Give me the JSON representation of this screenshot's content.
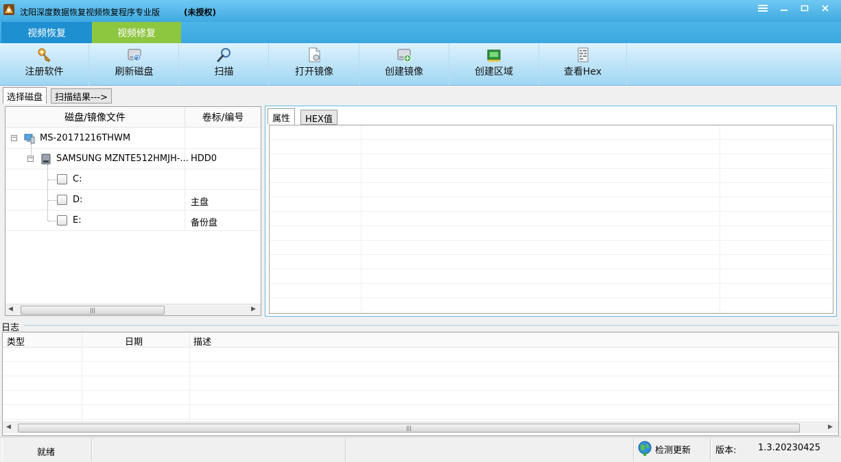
{
  "window": {
    "title": "沈阳深度数据恢复视频恢复程序专业版",
    "status": "(未授权)"
  },
  "mode_tabs": [
    {
      "label": "视频恢复"
    },
    {
      "label": "视频修复"
    }
  ],
  "toolbar": [
    {
      "label": "注册软件",
      "icon": "key-icon"
    },
    {
      "label": "刷新磁盘",
      "icon": "refresh-disk-icon"
    },
    {
      "label": "扫描",
      "icon": "magnifier-icon"
    },
    {
      "label": "打开镜像",
      "icon": "open-image-icon"
    },
    {
      "label": "创建镜像",
      "icon": "create-image-icon"
    },
    {
      "label": "创建区域",
      "icon": "create-region-icon"
    },
    {
      "label": "查看Hex",
      "icon": "hex-view-icon"
    }
  ],
  "main_tabs": [
    {
      "label": "选择磁盘"
    },
    {
      "label": "扫描结果--->"
    }
  ],
  "disk_tree": {
    "columns": [
      "磁盘/镜像文件",
      "卷标/编号"
    ],
    "rows": [
      {
        "name": "MS-20171216THWM",
        "label": "",
        "icon": "computer-icon"
      },
      {
        "name": "SAMSUNG MZNTE512HMJH-...",
        "label": "HDD0",
        "icon": "hard-disk-icon"
      },
      {
        "name": "C:",
        "label": ""
      },
      {
        "name": "D:",
        "label": "主盘"
      },
      {
        "name": "E:",
        "label": "备份盘"
      }
    ]
  },
  "detail_tabs": [
    {
      "label": "属性"
    },
    {
      "label": "HEX值"
    }
  ],
  "log": {
    "title": "日志",
    "columns": [
      "类型",
      "日期",
      "描述"
    ]
  },
  "statusbar": {
    "state": "就绪",
    "check_update": "检测更新",
    "version_label": "版本:",
    "version": "1.3.20230425"
  },
  "colors": {
    "title_bg": "#3fa9e0",
    "tab_active_blue": "#1e8fd0",
    "tab_active_green": "#8dc63f"
  }
}
